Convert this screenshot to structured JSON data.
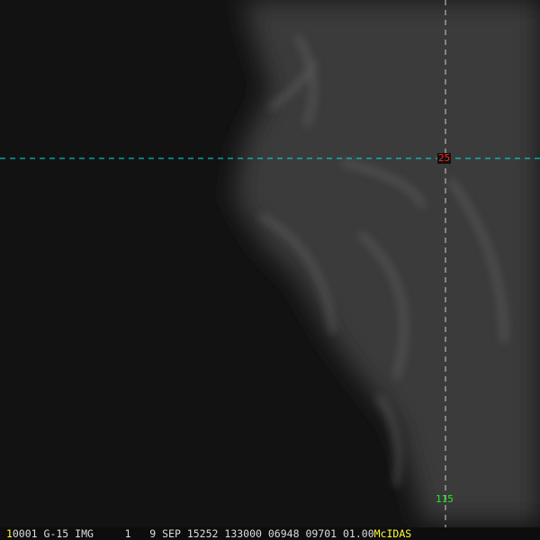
{
  "overlay": {
    "latitude_label": "25",
    "longitude_label": "115",
    "colors": {
      "lat_line": "#00e5e5",
      "lon_line": "#cccccc",
      "lat_label": "#ff2020",
      "lon_label": "#22ee22",
      "brand": "#ffff33"
    }
  },
  "status_bar": {
    "frame": "1",
    "area": "0001",
    "satellite": "G-15",
    "type": "IMG",
    "band": "1",
    "date": "9 SEP 15252",
    "time": "133000",
    "line": "06948",
    "element": "09701",
    "res": "01.00",
    "brand": "McIDAS"
  }
}
